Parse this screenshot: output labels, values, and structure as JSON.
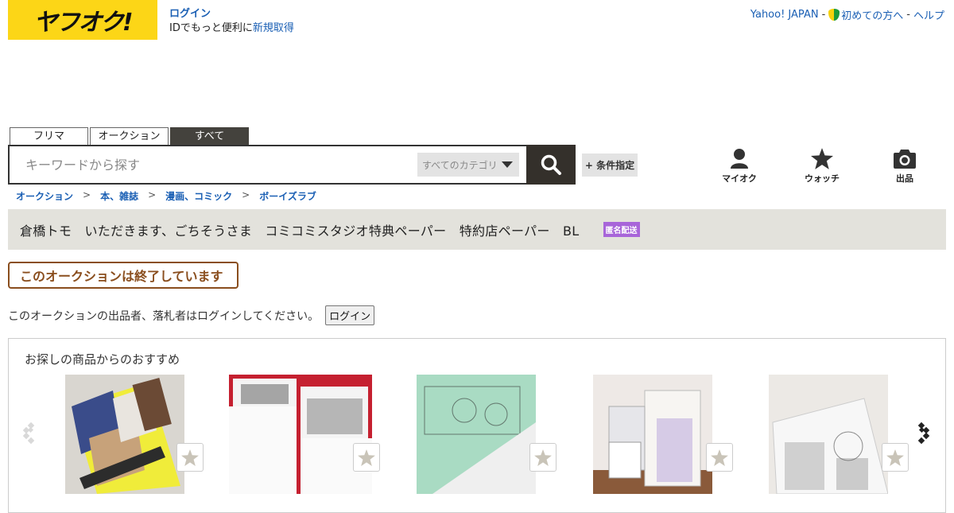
{
  "header": {
    "logo_text": "ヤフオク!",
    "login_label": "ログイン",
    "id_text": "IDでもっと便利に",
    "register_label": "新規取得",
    "links": {
      "yahoo_japan": "Yahoo! JAPAN",
      "beginner": "初めての方へ",
      "help": "ヘルプ",
      "separator": "-"
    }
  },
  "search": {
    "tabs": [
      "フリマ",
      "オークション",
      "すべて"
    ],
    "active_tab": "すべて",
    "placeholder": "キーワードから探す",
    "category": "すべてのカテゴリ",
    "condition_label": "+ 条件指定"
  },
  "quick_links": [
    "マイオク",
    "ウォッチ",
    "出品"
  ],
  "breadcrumb": [
    "オークション",
    "本、雑誌",
    "漫画、コミック",
    "ボーイズラブ"
  ],
  "breadcrumb_sep": ">",
  "item": {
    "title": "倉橋トモ　いただきます、ごちそうさま　コミコミスタジオ特典ペーパー　特約店ペーパー　BL",
    "badge": "匿名配送"
  },
  "status": {
    "ended": "このオークションは終了しています",
    "login_note": "このオークションの出品者、落札者はログインしてください。",
    "login_button": "ログイン"
  },
  "recommend": {
    "title": "お探しの商品からのおすすめ"
  },
  "colors": {
    "logo_yellow": "#fcd617",
    "link_blue": "#1a5fb4",
    "dark": "#34302b",
    "ended_brown": "#8a4e1e",
    "badge_purple": "#a865d9"
  }
}
